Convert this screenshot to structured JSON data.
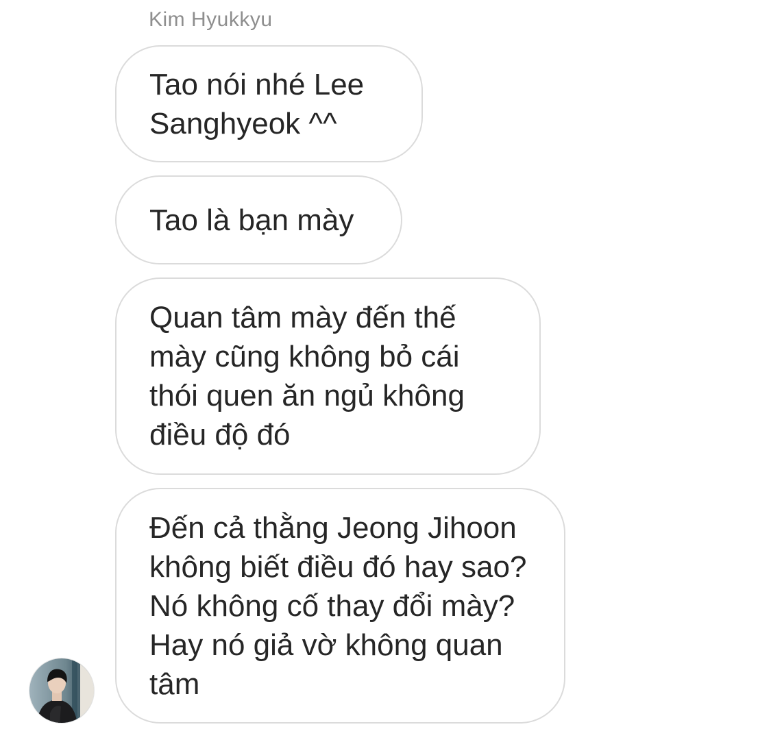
{
  "thread": {
    "sender_name": "Kim Hyukkyu",
    "messages": [
      {
        "text": "Tao nói nhé Lee Sanghyeok ^^"
      },
      {
        "text": "Tao là bạn mày"
      },
      {
        "text": "Quan tâm mày đến thế mày cũng không bỏ cái thói quen ăn ngủ không điều độ đó"
      },
      {
        "text": "Đến cả thằng Jeong Jihoon không biết điều đó hay sao? Nó không cố thay đổi mày? Hay nó giả vờ không quan tâm"
      }
    ],
    "avatar_icon": "profile-photo"
  }
}
